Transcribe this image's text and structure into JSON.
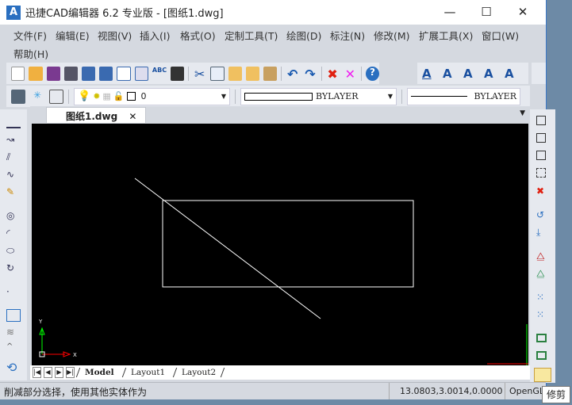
{
  "window": {
    "title": "迅捷CAD编辑器 6.2 专业版  - [图纸1.dwg]",
    "logo": "A",
    "minimize": "—",
    "maximize": "☐",
    "close": "✕"
  },
  "menu": [
    "文件(F)",
    "编辑(E)",
    "视图(V)",
    "插入(I)",
    "格式(O)",
    "定制工具(T)",
    "绘图(D)",
    "标注(N)",
    "修改(M)",
    "扩展工具(X)",
    "窗口(W)",
    "帮助(H)"
  ],
  "layer_toolbar": {
    "layer_value": "0",
    "color_value": "BYLAYER",
    "linetype_value": "BYLAYER"
  },
  "document_tab": {
    "label": "图纸1.dwg",
    "close": "✕"
  },
  "ucs": {
    "x_label": "X",
    "y_label": "Y"
  },
  "layout_tabs": [
    "Model",
    "Layout1",
    "Layout2"
  ],
  "status": {
    "message": "削减部分选择，使用其他实体作为",
    "coordinates": "13.0803,3.0014,0.0000",
    "renderer": "OpenGL"
  },
  "tooltip": "修剪",
  "colors": {
    "canvas": "#000000",
    "accent": "#2a6fc0",
    "x_axis": "#ff0000",
    "y_axis": "#00ff00"
  }
}
